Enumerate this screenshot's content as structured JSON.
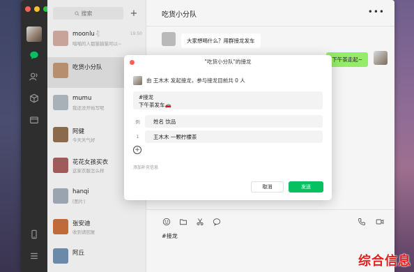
{
  "window": {
    "sidebar": {
      "icons": [
        "chat-icon",
        "contacts-icon",
        "cube-icon",
        "folder-icon",
        "phone-icon",
        "menu-icon"
      ]
    },
    "chatlist": {
      "search_placeholder": "搜索",
      "add_label": "+",
      "items": [
        {
          "name": "moonlu🐇",
          "preview": "喵喵的人都猫猫猫可以~",
          "time": "19:50",
          "avatar_color": "#c7a39a"
        },
        {
          "name": "吃货小分队",
          "preview": "",
          "time": "",
          "avatar_color": "#b78e6e"
        },
        {
          "name": "mumu",
          "preview": "我还没开始写呢",
          "time": "",
          "avatar_color": "#a8b0b8"
        },
        {
          "name": "阿健",
          "preview": "今天天气好",
          "time": "",
          "avatar_color": "#8a6a4a"
        },
        {
          "name": "花花女孩买衣",
          "preview": "这家衣服怎么样",
          "time": "",
          "avatar_color": "#a05a5a"
        },
        {
          "name": "hanqi",
          "preview": "[图片]",
          "time": "",
          "avatar_color": "#9aa4b0"
        },
        {
          "name": "张安迪",
          "preview": "收到请回复",
          "time": "",
          "avatar_color": "#c06a3a"
        },
        {
          "name": "阿丘",
          "preview": "",
          "time": "",
          "avatar_color": "#6a8aa8"
        }
      ]
    },
    "conversation": {
      "title": "吃货小分队",
      "more_label": "•••",
      "messages": [
        {
          "side": "left",
          "text": "大家想喝什么？用群接龙发车"
        },
        {
          "side": "right",
          "text": "下午茶走起~"
        }
      ],
      "composer": {
        "tools": [
          "emoji-icon",
          "folder-icon",
          "scissors-icon",
          "chat-bubble-icon"
        ],
        "right_tools": [
          "phone-icon",
          "video-icon"
        ],
        "text": "#接龙"
      }
    },
    "dialog": {
      "title": "\"吃货小分队\"的接龙",
      "info": "由 王木木 发起接龙，参与接龙目前共 0 人",
      "topic_line1": "#接龙",
      "topic_line2": "下午茶发车🚗",
      "example_num": "例",
      "example_text": "姓名 饮品",
      "entry_num": "1",
      "entry_text": "王木木 一颗柠檬茶",
      "add_label": "+",
      "add_note": "添加补充信息",
      "cancel_label": "取消",
      "send_label": "发送"
    }
  },
  "watermark": "综合信息",
  "colors": {
    "send_green": "#07c160",
    "bubble_green": "#95ec69",
    "watermark_red": "#e02020"
  }
}
